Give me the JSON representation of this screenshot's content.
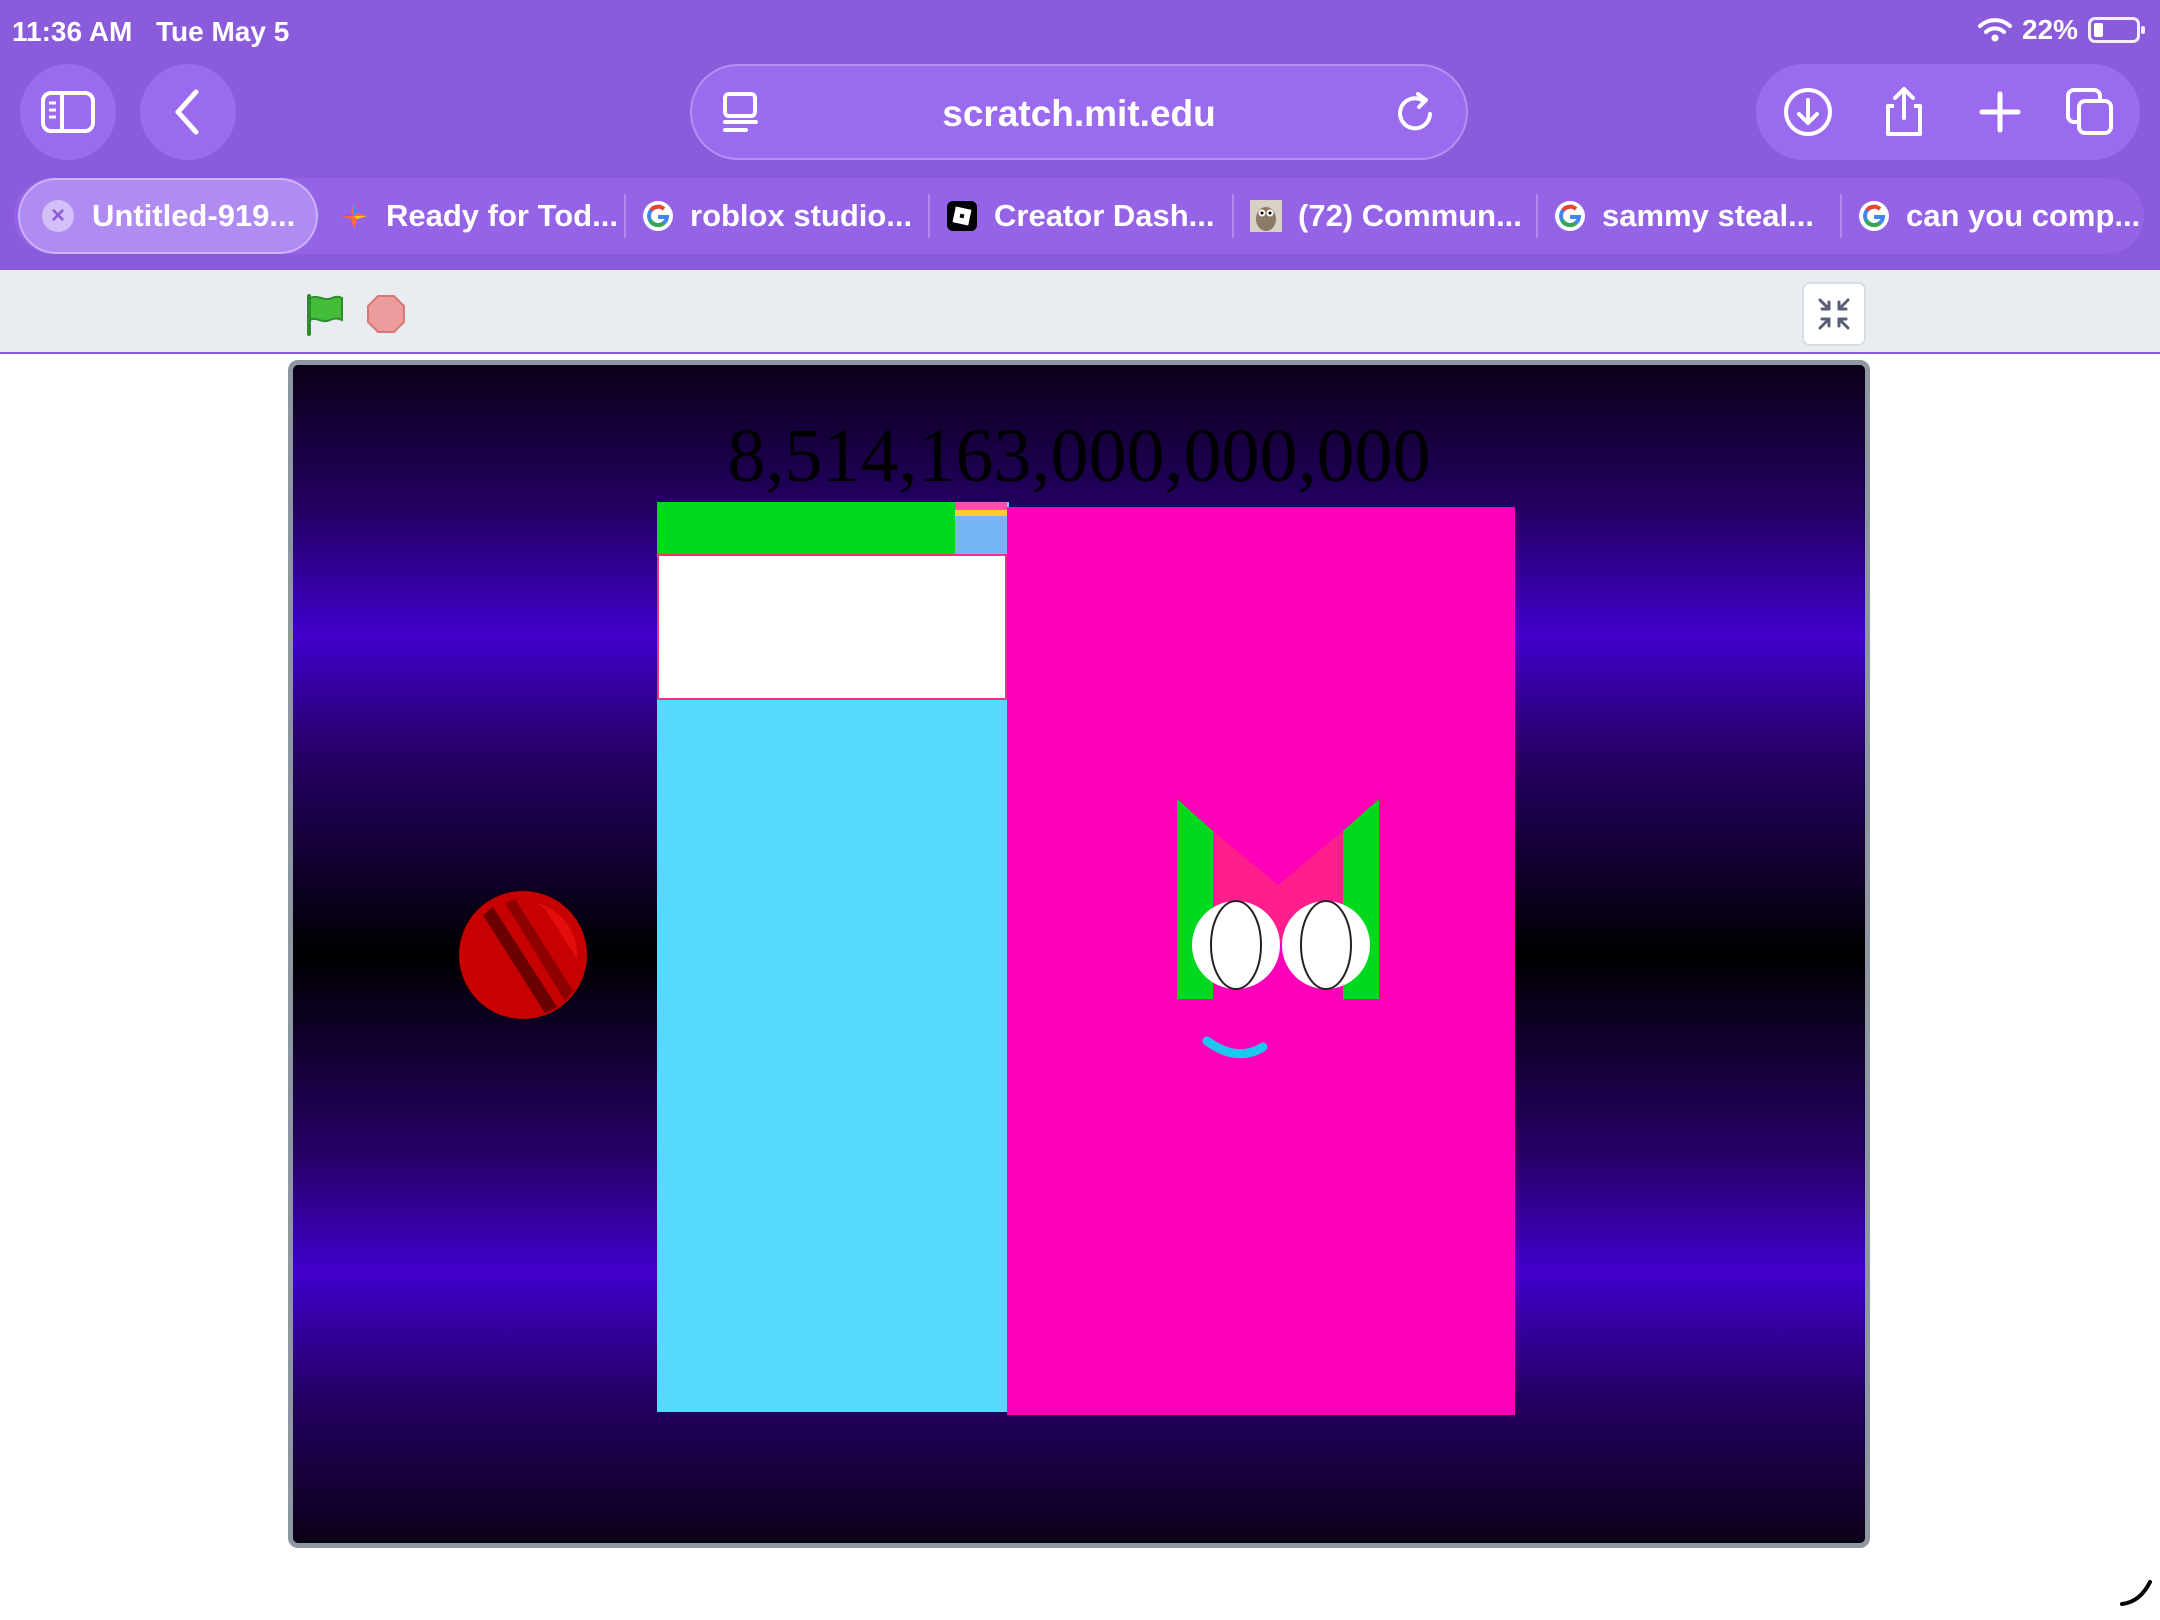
{
  "status_bar": {
    "time": "11:36 AM",
    "date": "Tue May 5",
    "battery": "22%"
  },
  "toolbar": {
    "url": "scratch.mit.edu",
    "icons": [
      "sidebar-icon",
      "back-icon",
      "reader-icon",
      "reload-icon",
      "download-icon",
      "share-icon",
      "plus-icon",
      "tabs-icon"
    ]
  },
  "tabs": [
    {
      "label": "Untitled-919...",
      "favicon": "scratch",
      "active": true
    },
    {
      "label": "Ready for Tod...",
      "favicon": "colorful-star"
    },
    {
      "label": "roblox studio...",
      "favicon": "google"
    },
    {
      "label": "Creator Dash...",
      "favicon": "roblox"
    },
    {
      "label": "(72) Commun...",
      "favicon": "owl"
    },
    {
      "label": "sammy steal...",
      "favicon": "google"
    },
    {
      "label": "can you comp...",
      "favicon": "google"
    }
  ],
  "player": {
    "controls": [
      "green-flag",
      "stop",
      "exit-fullscreen"
    ]
  },
  "stage": {
    "score": "8,514,163,000,000,000",
    "colors": {
      "blue_panel": "#57d9ff",
      "pink_panel": "#ff00b9",
      "green_strip": "#00d91d",
      "ball": "#cc0000"
    }
  }
}
